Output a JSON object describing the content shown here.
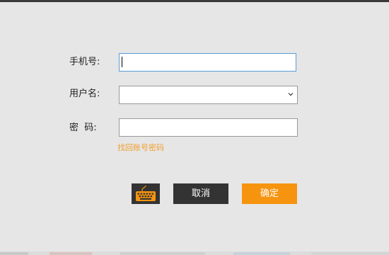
{
  "form": {
    "phone": {
      "label": "手机号:",
      "value": "",
      "placeholder": ""
    },
    "username": {
      "label": "用户名:",
      "selected": ""
    },
    "password": {
      "label": "密  码:",
      "value": "",
      "placeholder": ""
    },
    "recover_link": "找回账号密码"
  },
  "buttons": {
    "keyboard_icon": "keyboard-icon",
    "cancel_label": "取消",
    "confirm_label": "确定"
  },
  "colors": {
    "background": "#e6e6e6",
    "accent": "#f7940f",
    "dark_button": "#333333",
    "link": "#f0a030",
    "focus_border": "#5b9bd5"
  }
}
